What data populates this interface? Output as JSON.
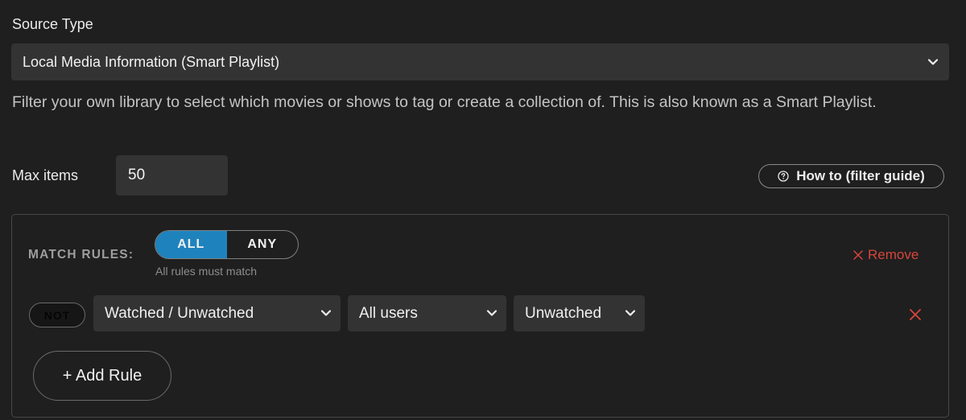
{
  "source": {
    "label": "Source Type",
    "selected": "Local Media Information (Smart Playlist)",
    "description": "Filter your own library to select which movies or shows to tag or create a collection of. This is also known as a Smart Playlist."
  },
  "max_items": {
    "label": "Max items",
    "value": "50"
  },
  "help": {
    "label": "How to (filter guide)",
    "icon": "question-circle-icon"
  },
  "rules": {
    "match_label": "MATCH RULES:",
    "toggle": {
      "options": [
        "ALL",
        "ANY"
      ],
      "active": "ALL"
    },
    "hint": "All rules must match",
    "remove_label": "Remove",
    "items": [
      {
        "not_label": "NOT",
        "field": "Watched / Unwatched",
        "scope": "All users",
        "value": "Unwatched"
      }
    ],
    "add_label": "+ Add Rule"
  },
  "colors": {
    "background": "#1f1f1f",
    "accent": "#1e83bd",
    "danger": "#d6453d",
    "field_bg": "#333333"
  }
}
